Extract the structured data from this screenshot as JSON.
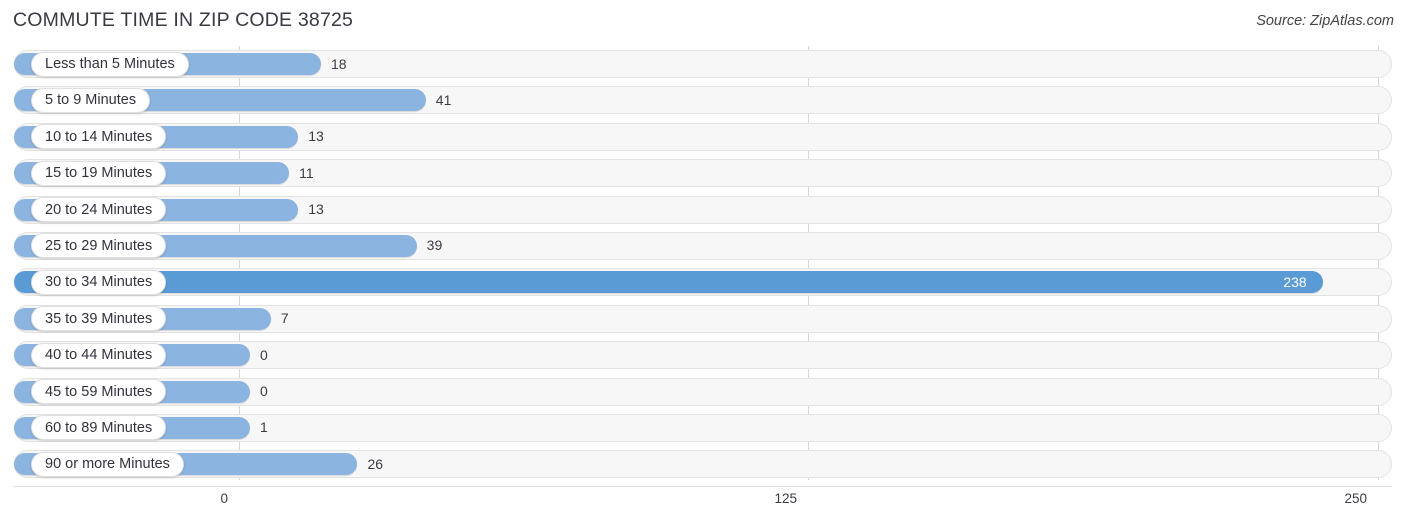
{
  "header": {
    "title": "COMMUTE TIME IN ZIP CODE 38725",
    "source": "Source: ZipAtlas.com"
  },
  "chart_data": {
    "type": "bar",
    "orientation": "horizontal",
    "title": "COMMUTE TIME IN ZIP CODE 38725",
    "xlabel": "",
    "ylabel": "",
    "xlim": [
      0,
      250
    ],
    "xticks": [
      "0",
      "125",
      "250"
    ],
    "grid": true,
    "legend": null,
    "highlight_category": "30 to 34 Minutes",
    "colors": {
      "bar": "#8cb4e0",
      "bar_highlight": "#5b9bd5",
      "track": "#f7f7f7",
      "gridline": "#d6d6d6",
      "label_text": "#32323c",
      "value_text": "#3c3c44",
      "value_text_inside": "#ffffff"
    },
    "categories": [
      "Less than 5 Minutes",
      "5 to 9 Minutes",
      "10 to 14 Minutes",
      "15 to 19 Minutes",
      "20 to 24 Minutes",
      "25 to 29 Minutes",
      "30 to 34 Minutes",
      "35 to 39 Minutes",
      "40 to 44 Minutes",
      "45 to 59 Minutes",
      "60 to 89 Minutes",
      "90 or more Minutes"
    ],
    "values": [
      18,
      41,
      13,
      11,
      13,
      39,
      238,
      7,
      0,
      0,
      1,
      26
    ],
    "value_labels": [
      "18",
      "41",
      "13",
      "11",
      "13",
      "39",
      "238",
      "7",
      "0",
      "0",
      "1",
      "26"
    ]
  }
}
